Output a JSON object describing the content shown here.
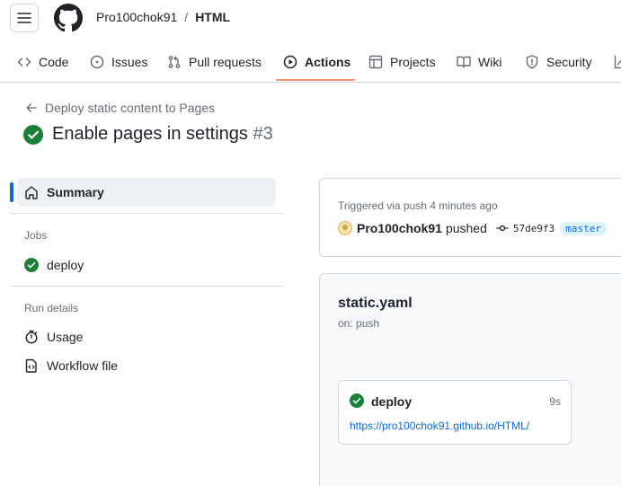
{
  "header": {
    "owner": "Pro100chok91",
    "separator": "/",
    "repo": "HTML"
  },
  "tabs": [
    {
      "label": "Code",
      "icon": "code-icon"
    },
    {
      "label": "Issues",
      "icon": "issue-icon"
    },
    {
      "label": "Pull requests",
      "icon": "pull-request-icon"
    },
    {
      "label": "Actions",
      "icon": "play-icon",
      "active": true
    },
    {
      "label": "Projects",
      "icon": "table-icon"
    },
    {
      "label": "Wiki",
      "icon": "book-icon"
    },
    {
      "label": "Security",
      "icon": "shield-icon"
    }
  ],
  "page": {
    "back_label": "Deploy static content to Pages",
    "title": "Enable pages in settings",
    "run_number": "#3"
  },
  "sidebar": {
    "summary": "Summary",
    "jobs_heading": "Jobs",
    "job": "deploy",
    "run_details_heading": "Run details",
    "usage": "Usage",
    "workflow_file": "Workflow file"
  },
  "trigger": {
    "text": "Triggered via push 4 minutes ago",
    "user": "Pro100chok91",
    "verb": "pushed",
    "commit": "57de9f3",
    "branch": "master"
  },
  "workflow": {
    "name": "static.yaml",
    "on": "on: push",
    "job": {
      "name": "deploy",
      "duration": "9s",
      "url": "https://pro100chok91.github.io/HTML/"
    }
  },
  "colors": {
    "success": "#1a7f37",
    "active_tab_underline": "#fd8c73",
    "link": "#0969da"
  }
}
